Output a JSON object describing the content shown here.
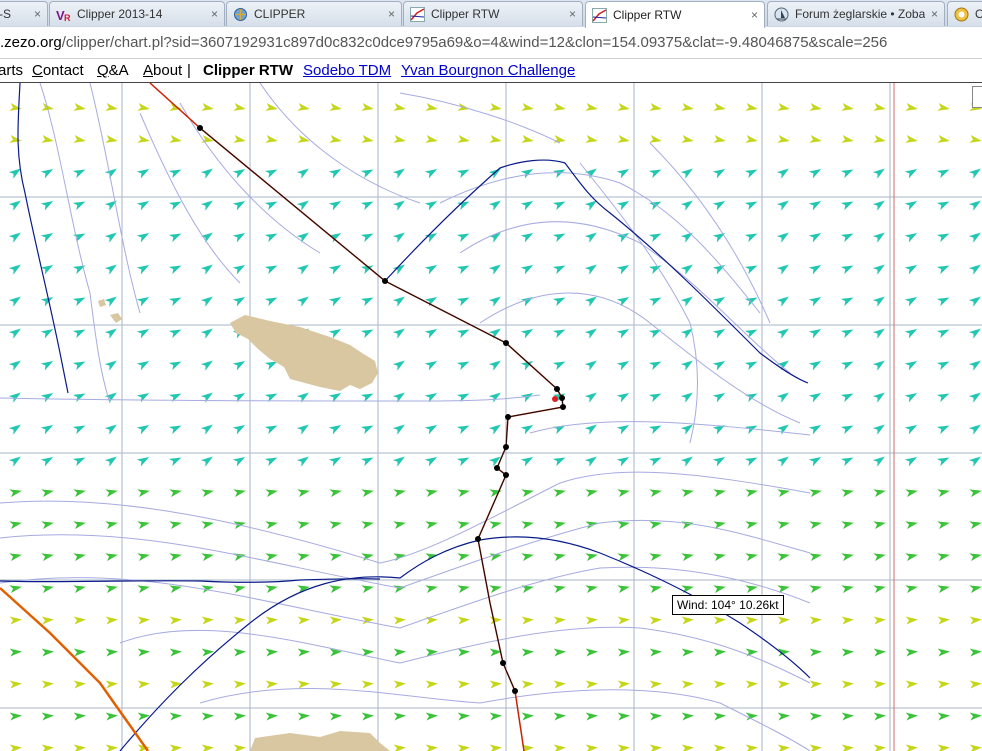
{
  "browser": {
    "tabs": [
      {
        "label": "-S",
        "active": false,
        "icon": "page-icon"
      },
      {
        "label": "Clipper 2013-14",
        "active": false,
        "icon": "vr-logo-icon"
      },
      {
        "label": "CLIPPER",
        "active": false,
        "icon": "globe-icon"
      },
      {
        "label": "Clipper RTW",
        "active": false,
        "icon": "chart-line-icon"
      },
      {
        "label": "Clipper RTW",
        "active": true,
        "icon": "chart-line-icon"
      },
      {
        "label": "Forum żeglarskie • Zoba",
        "active": false,
        "icon": "sailboat-icon"
      },
      {
        "label": "O",
        "active": false,
        "icon": "circle-icon"
      }
    ],
    "close_glyph": "×",
    "address": {
      "domain": ".zezo.org",
      "path": "/clipper/chart.pl?sid=3607192931c897d0c832c0dce9795a69&o=4&wind=12&clon=154.09375&clat=-9.48046875&scale=256"
    }
  },
  "site_nav": {
    "items": [
      {
        "label": "arts"
      },
      {
        "label": "Contact",
        "u": "C",
        "rest": "ontact"
      },
      {
        "label": "Q&A",
        "u": "Q",
        "rest": "&A"
      },
      {
        "label": "About",
        "u": "A",
        "rest": "bout"
      },
      {
        "label": "|"
      }
    ],
    "current": "Clipper RTW",
    "links": [
      "Sodebo TDM",
      "Yvan Bourgnon Challenge"
    ]
  },
  "chart": {
    "wind_tooltip": "Wind:  104°  10.26kt",
    "colors": {
      "land": "#d8c7a0",
      "grid": "#a9b6c9",
      "isobar": "#9aa0d8",
      "contour": "#0a1a8a",
      "route": "#cc2200",
      "track": "#111111",
      "boundary": "#e06000",
      "arrow_yellow": "#c6d51a",
      "arrow_green": "#3ac43a",
      "arrow_teal": "#22c7b0"
    }
  }
}
